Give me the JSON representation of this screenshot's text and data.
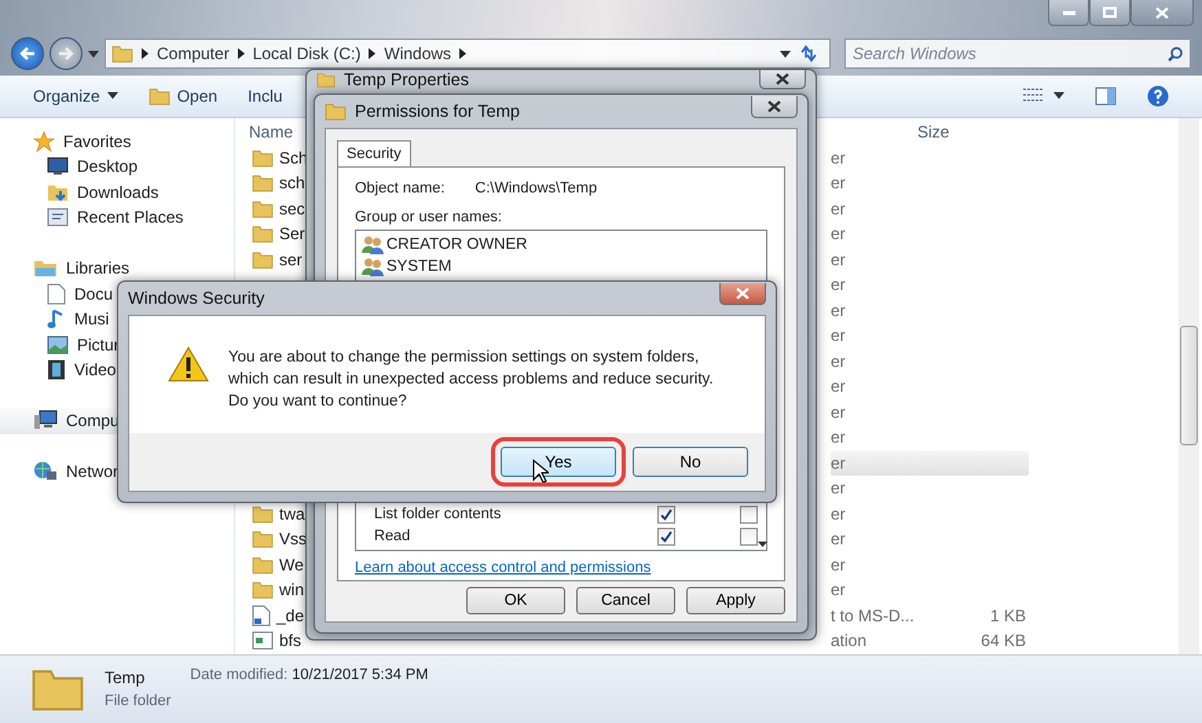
{
  "explorer": {
    "breadcrumb": [
      "Computer",
      "Local Disk (C:)",
      "Windows"
    ],
    "search": {
      "placeholder": "Search Windows"
    },
    "toolbar": [
      "Organize",
      "Open",
      "Inclu"
    ],
    "nav": [
      {
        "kind": "favorites",
        "label": "Favorites",
        "selected": false
      },
      {
        "kind": "desktop",
        "label": "Desktop",
        "selected": false
      },
      {
        "kind": "downloads",
        "label": "Downloads",
        "selected": false
      },
      {
        "kind": "recent",
        "label": "Recent Places",
        "selected": false
      },
      {
        "kind": "libraries",
        "label": "Libraries",
        "selected": false
      },
      {
        "kind": "documents",
        "label": "Docu",
        "selected": false
      },
      {
        "kind": "music",
        "label": "Musi",
        "selected": false
      },
      {
        "kind": "pictures",
        "label": "Pictur",
        "selected": false
      },
      {
        "kind": "videos",
        "label": "Video",
        "selected": false
      },
      {
        "kind": "computer",
        "label": "Compu",
        "selected": true
      },
      {
        "kind": "network",
        "label": "Networ",
        "selected": false
      }
    ],
    "columns": [
      "Name",
      "Size"
    ],
    "rows": [
      {
        "kind": "folder",
        "name": "Sch",
        "type": "er",
        "selected": false
      },
      {
        "kind": "folder",
        "name": "sch",
        "type": "er",
        "selected": false
      },
      {
        "kind": "folder",
        "name": "sec",
        "type": "er",
        "selected": false
      },
      {
        "kind": "folder",
        "name": "Ser",
        "type": "er",
        "selected": false
      },
      {
        "kind": "folder",
        "name": "ser",
        "type": "er",
        "selected": false
      },
      {
        "kind": "hidden",
        "type": "er",
        "selected": false
      },
      {
        "kind": "hidden",
        "type": "er",
        "selected": false
      },
      {
        "kind": "hidden",
        "type": "er",
        "selected": false
      },
      {
        "kind": "hidden",
        "type": "er",
        "selected": false
      },
      {
        "kind": "hidden",
        "type": "er",
        "selected": false
      },
      {
        "kind": "hidden",
        "type": "er",
        "selected": false
      },
      {
        "kind": "hidden",
        "type": "er",
        "selected": false
      },
      {
        "kind": "hidden",
        "type": "er",
        "selected": true
      },
      {
        "kind": "hidden",
        "type": "er",
        "selected": false
      },
      {
        "kind": "folder",
        "name": "twa",
        "type": "er",
        "selected": false
      },
      {
        "kind": "folder",
        "name": "Vss",
        "type": "er",
        "selected": false
      },
      {
        "kind": "folder",
        "name": "We",
        "type": "er",
        "selected": false
      },
      {
        "kind": "folder",
        "name": "win",
        "type": "er",
        "selected": false
      },
      {
        "kind": "shortcut",
        "name": "_de",
        "type": "t to MS-D...",
        "size": "1 KB",
        "selected": false
      },
      {
        "kind": "file",
        "name": "bfs",
        "type": "ation",
        "size": "64 KB",
        "selected": false
      }
    ],
    "status": {
      "name": "Temp",
      "type": "File folder",
      "modified_label": "Date modified:",
      "modified": "10/21/2017 5:34 PM"
    }
  },
  "properties": {
    "title": "Temp Properties"
  },
  "permissions": {
    "title": "Permissions for Temp",
    "tab": "Security",
    "object_label": "Object name:",
    "object_value": "C:\\Windows\\Temp",
    "group_label": "Group or user names:",
    "users": [
      "CREATOR OWNER",
      "SYSTEM"
    ],
    "perms": [
      {
        "name": "List folder contents",
        "allow": true,
        "deny": false
      },
      {
        "name": "Read",
        "allow": true,
        "deny": false
      }
    ],
    "link": "Learn about access control and permissions",
    "buttons": [
      "OK",
      "Cancel",
      "Apply"
    ]
  },
  "security": {
    "title": "Windows Security",
    "message": "You are about to change the permission settings on system folders,\nwhich can result in unexpected access problems and reduce security.\nDo you want to continue?",
    "buttons": [
      {
        "label": "Yes",
        "highlighted": true
      },
      {
        "label": "No",
        "highlighted": false
      }
    ]
  }
}
